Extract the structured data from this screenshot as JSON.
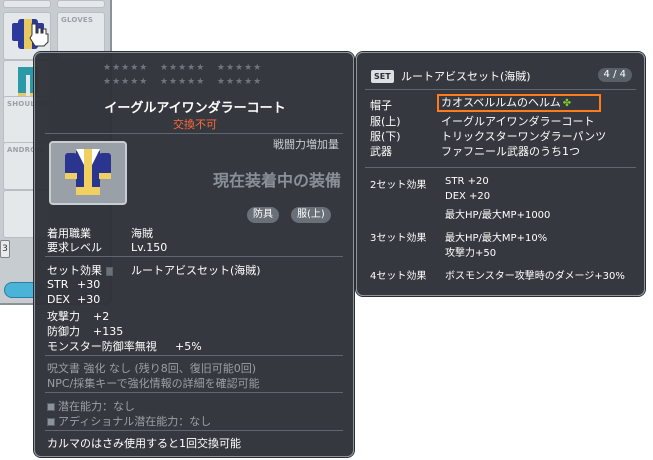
{
  "equip_window": {
    "slot_labels": [
      "GLOVES",
      "SHOULDER",
      "ANDROID"
    ],
    "side_button_label": "3"
  },
  "item_tooltip": {
    "stars": [
      "★★★★★",
      "★★★★★",
      "★★★★★",
      "★★★★★",
      "★★★★★",
      "★★★★★"
    ],
    "name": "イーグルアイワンダラーコート",
    "untradeable": "交換不可",
    "combat_power_label": "戦闘力増加量",
    "equipped_label": "現在装着中の装備",
    "tags": [
      "防具",
      "服(上)"
    ],
    "requirements": [
      {
        "key": "着用職業",
        "value": "海賊"
      },
      {
        "key": "要求レベル",
        "value": "Lv.150"
      }
    ],
    "set_effect_label": "セット効果",
    "set_effect_value": "ルートアビスセット(海賊)",
    "stats": [
      {
        "key": "STR",
        "value": "+30"
      },
      {
        "key": "DEX",
        "value": "+30"
      },
      {
        "key": "攻撃力",
        "value": "+2"
      },
      {
        "key": "防御力",
        "value": "+135"
      },
      {
        "key": "モンスター防御率無視",
        "value": "+5%"
      }
    ],
    "upgrade_info": "呪文書 強化 なし (残り8回、復旧可能0回)",
    "npc_info": "NPC/採集キーで強化情報の詳細を確認可能",
    "potential": "潜在能力：なし",
    "additional_potential": "アディショナル潜在能力：なし",
    "karma_note": "カルマのはさみ使用すると1回交換可能"
  },
  "set_tooltip": {
    "badge": "SET",
    "title": "ルートアビスセット(海賊)",
    "count": "4 / 4",
    "items": [
      {
        "slot": "帽子",
        "name": "カオスベルルムのヘルム",
        "highlight": true
      },
      {
        "slot": "服(上)",
        "name": "イーグルアイワンダラーコート",
        "highlight": false
      },
      {
        "slot": "服(下)",
        "name": "トリックスターワンダラーパンツ",
        "highlight": false
      },
      {
        "slot": "武器",
        "name": "ファフニール武器のうち1つ",
        "highlight": false
      }
    ],
    "bonuses": [
      {
        "label": "2セット効果",
        "lines": [
          "STR +20",
          "DEX +20",
          "最大HP/最大MP+1000"
        ]
      },
      {
        "label": "3セット効果",
        "lines": [
          "最大HP/最大MP+10%",
          "攻撃力+50"
        ]
      },
      {
        "label": "4セット効果",
        "lines": [
          "ボスモンスター攻撃時のダメージ+30%"
        ]
      }
    ],
    "highlight_color": "#ff7b1c"
  }
}
